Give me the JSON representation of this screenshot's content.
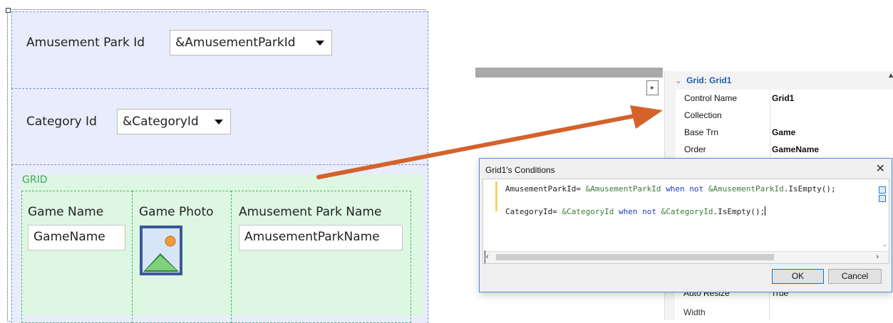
{
  "designer": {
    "park_label": "Amusement Park Id",
    "park_combo_value": "&AmusementParkId",
    "category_label": "Category Id",
    "category_combo_value": "&CategoryId",
    "grid_title": "GRID",
    "columns": [
      {
        "header": "Game Name",
        "field": "GameName"
      },
      {
        "header": "Game Photo",
        "field": ""
      },
      {
        "header": "Amusement Park Name",
        "field": "AmusementParkName"
      }
    ]
  },
  "properties": {
    "section_title": "Grid: Grid1",
    "rows": [
      {
        "name": "Control Name",
        "value": "Grid1"
      },
      {
        "name": "Collection",
        "value": ""
      },
      {
        "name": "Base Trn",
        "value": "Game"
      },
      {
        "name": "Order",
        "value": "GameName"
      }
    ],
    "partial_rows": [
      {
        "name": "Auto Resize",
        "value": "True"
      },
      {
        "name": "Width",
        "value": ""
      }
    ]
  },
  "dialog": {
    "title": "Grid1's Conditions",
    "line1": {
      "attr": "AmusementParkId=",
      "var1": "&AmusementParkId",
      "kw1": "when",
      "kw2": "not",
      "var2": "&AmusementParkId",
      "suffix": ".IsEmpty();"
    },
    "line2": {
      "attr": "CategoryId=",
      "var1": "&CategoryId",
      "kw1": "when",
      "kw2": "not",
      "var2": "&CategoryId",
      "suffix": ".IsEmpty();"
    },
    "ok_label": "OK",
    "cancel_label": "Cancel"
  },
  "icons": {
    "close": "close-icon",
    "photo": "image-placeholder-icon",
    "arrow": "annotation-arrow",
    "arrow_color": "#d4622a"
  }
}
